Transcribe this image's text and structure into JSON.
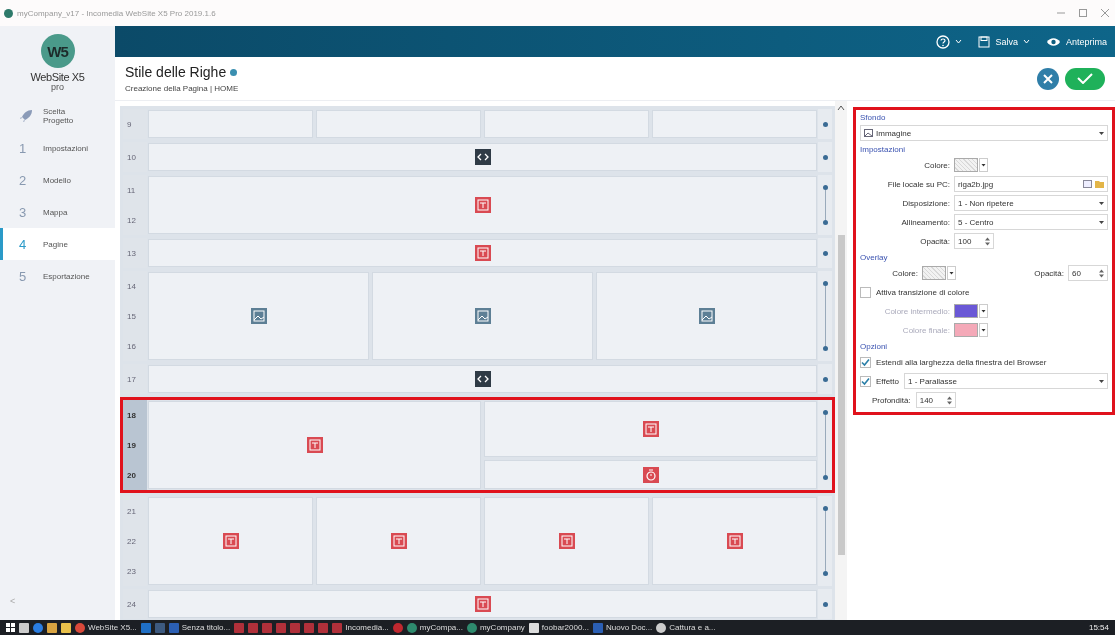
{
  "titlebar": {
    "title": "myCompany_v17 - Incomedia WebSite X5 Pro 2019.1.6"
  },
  "sidebar": {
    "logo": "W5",
    "brand": "WebSite X5",
    "edition": "pro",
    "collapse": "<",
    "items": [
      {
        "kind": "rocket",
        "label": "Scelta Progetto",
        "selected": false
      },
      {
        "kind": "number",
        "marker": "1",
        "label": "Impostazioni",
        "selected": false
      },
      {
        "kind": "number",
        "marker": "2",
        "label": "Modello",
        "selected": false
      },
      {
        "kind": "number",
        "marker": "3",
        "label": "Mappa",
        "selected": false
      },
      {
        "kind": "number",
        "marker": "4",
        "label": "Pagine",
        "selected": true
      },
      {
        "kind": "number",
        "marker": "5",
        "label": "Esportazione",
        "selected": false
      }
    ]
  },
  "toolbar": {
    "save": "Salva",
    "preview": "Anteprima"
  },
  "header": {
    "title": "Stile delle Righe",
    "subtitle": "Creazione della Pagina | HOME"
  },
  "grid": {
    "blocks": [
      {
        "rows": [
          "9"
        ],
        "selected": false,
        "columns": [
          [
            {
              "kind": "empty"
            }
          ],
          [
            {
              "kind": "empty"
            }
          ],
          [
            {
              "kind": "empty"
            }
          ],
          [
            {
              "kind": "empty"
            }
          ]
        ]
      },
      {
        "rows": [
          "10"
        ],
        "selected": false,
        "columns": [
          [
            {
              "kind": "code"
            }
          ]
        ]
      },
      {
        "rows": [
          "11",
          "12"
        ],
        "selected": false,
        "columns": [
          [
            {
              "kind": "text"
            }
          ]
        ]
      },
      {
        "rows": [
          "13"
        ],
        "selected": false,
        "columns": [
          [
            {
              "kind": "text"
            }
          ]
        ]
      },
      {
        "rows": [
          "14",
          "15",
          "16"
        ],
        "selected": false,
        "columns": [
          [
            {
              "kind": "image"
            }
          ],
          [
            {
              "kind": "image"
            }
          ],
          [
            {
              "kind": "image"
            }
          ]
        ]
      },
      {
        "rows": [
          "17"
        ],
        "selected": false,
        "columns": [
          [
            {
              "kind": "code"
            }
          ]
        ]
      },
      {
        "rows": [
          "18",
          "19",
          "20"
        ],
        "selected": true,
        "columns": [
          [
            {
              "kind": "text"
            }
          ],
          [
            {
              "kind": "text"
            },
            {
              "kind": "timer"
            }
          ]
        ]
      },
      {
        "rows": [
          "21",
          "22",
          "23"
        ],
        "selected": false,
        "columns": [
          [
            {
              "kind": "text"
            }
          ],
          [
            {
              "kind": "text"
            }
          ],
          [
            {
              "kind": "text"
            }
          ],
          [
            {
              "kind": "text"
            }
          ]
        ]
      },
      {
        "rows": [
          "24"
        ],
        "selected": false,
        "columns": [
          [
            {
              "kind": "text"
            }
          ]
        ]
      }
    ]
  },
  "panel": {
    "background": {
      "heading": "Sfondo",
      "type": "Immagine"
    },
    "settings": {
      "heading": "Impostazioni",
      "fields": [
        {
          "kind": "swatch",
          "label": "Colore:"
        },
        {
          "kind": "file",
          "label": "File locale su PC:",
          "value": "riga2b.jpg"
        },
        {
          "kind": "select",
          "label": "Disposizione:",
          "value": "1 - Non ripetere"
        },
        {
          "kind": "select",
          "label": "Allineamento:",
          "value": "5 - Centro"
        },
        {
          "kind": "spin",
          "label": "Opacità:",
          "value": "100"
        }
      ]
    },
    "overlay": {
      "heading": "Overlay",
      "color_label": "Colore:",
      "opacity_label": "Opacità:",
      "opacity": "60",
      "transition": {
        "label": "Attiva transizione di colore",
        "checked": false
      },
      "intermediate": {
        "label": "Colore intermedio:",
        "color": "#6a58d6"
      },
      "final": {
        "label": "Colore finale:",
        "color": "#f4a9b8"
      }
    },
    "options": {
      "heading": "Opzioni",
      "stretch": {
        "label": "Estendi alla larghezza della finestra del Browser",
        "checked": true
      },
      "effect": {
        "label": "Effetto",
        "checked": true,
        "value": "1 - Parallasse"
      },
      "depth": {
        "label": "Profondità:",
        "value": "140"
      }
    }
  },
  "taskbar": {
    "clock": "15:54",
    "items": [
      {
        "kind": "start"
      },
      {
        "kind": "taskview"
      },
      {
        "kind": "edge"
      },
      {
        "kind": "store"
      },
      {
        "kind": "folder"
      },
      {
        "kind": "chrome",
        "label": "WebSite X5..."
      },
      {
        "kind": "outlook"
      },
      {
        "kind": "lr"
      },
      {
        "kind": "ps",
        "label": "Senza titolo..."
      },
      {
        "kind": "x5"
      },
      {
        "kind": "x5"
      },
      {
        "kind": "x5"
      },
      {
        "kind": "x5"
      },
      {
        "kind": "x5"
      },
      {
        "kind": "x5"
      },
      {
        "kind": "x5"
      },
      {
        "kind": "x5",
        "label": "Incomedia..."
      },
      {
        "kind": "ws-red"
      },
      {
        "kind": "ws",
        "label": "myCompa..."
      },
      {
        "kind": "ws",
        "label": "myCompany"
      },
      {
        "kind": "foobar",
        "label": "foobar2000..."
      },
      {
        "kind": "word",
        "label": "Nuovo Doc..."
      },
      {
        "kind": "capture",
        "label": "Cattura e a..."
      }
    ]
  }
}
